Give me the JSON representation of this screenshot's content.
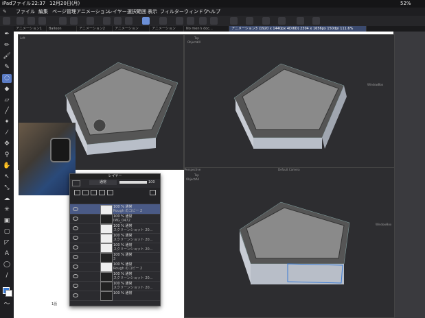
{
  "status": {
    "device": "iPad",
    "app": "ファイル",
    "time": "22:37",
    "date": "12月20日(月)",
    "battery": "52%"
  },
  "menu": [
    "ファイル",
    "編集",
    "ページ管理",
    "アニメーション",
    "レイヤー",
    "選択範囲",
    "表示",
    "フィルター",
    "ウィンドウ",
    "ヘルプ"
  ],
  "tabs": [
    {
      "label": "アニメーション1",
      "active": false
    },
    {
      "label": "Balloon",
      "active": false
    },
    {
      "label": "アニメーション2",
      "active": false
    },
    {
      "label": "アニメーション",
      "active": false
    },
    {
      "label": "アニメーション",
      "active": false
    },
    {
      "label": "No men's doc...",
      "active": false
    },
    {
      "label": "アニメーション3 (1920 x 1440px 4D/6D) 2304 x 1656px 150dpi 111.6%",
      "active": true
    }
  ],
  "views": {
    "top_left": {
      "label": "Left",
      "objects": "Objects",
      "all": "All"
    },
    "top_right": {
      "label": "Top",
      "objects": "Objects",
      "all": "All",
      "gizmo": "WindowBox"
    },
    "bottom": {
      "label": "Perspective",
      "camera": "Default Camera",
      "top": "Top",
      "objects": "Objects",
      "all": "All",
      "gizmo": "WindowBox"
    }
  },
  "layer_panel": {
    "title": "レイヤー",
    "blend": "通常",
    "opacity": "100",
    "layers": [
      {
        "pct": "100 % 通常",
        "name": "Rough のコピー 2",
        "selected": true,
        "dark": false
      },
      {
        "pct": "100 % 通常",
        "name": "IMG_0472",
        "selected": false,
        "dark": true
      },
      {
        "pct": "100 % 通常",
        "name": "スクリーンショット 20...",
        "selected": false,
        "dark": false
      },
      {
        "pct": "100 % 通常",
        "name": "スクリーンショット 20...",
        "selected": false,
        "dark": false
      },
      {
        "pct": "100 % 通常",
        "name": "スクリーンショット 20...",
        "selected": false,
        "dark": false
      },
      {
        "pct": "100 % 通常",
        "name": "3",
        "selected": false,
        "dark": true
      },
      {
        "pct": "100 % 通常",
        "name": "Rough のコピー 2",
        "selected": false,
        "dark": false
      },
      {
        "pct": "100 % 通常",
        "name": "スクリーンショット 20...",
        "selected": false,
        "dark": true
      },
      {
        "pct": "100 % 通常",
        "name": "スクリーンショット 20...",
        "selected": false,
        "dark": true
      },
      {
        "pct": "100 % 通常",
        "name": "",
        "selected": false,
        "dark": true
      }
    ]
  },
  "page_number": "1話",
  "colors": {
    "accent": "#5a7bc4",
    "selection": "#4a5a86"
  }
}
